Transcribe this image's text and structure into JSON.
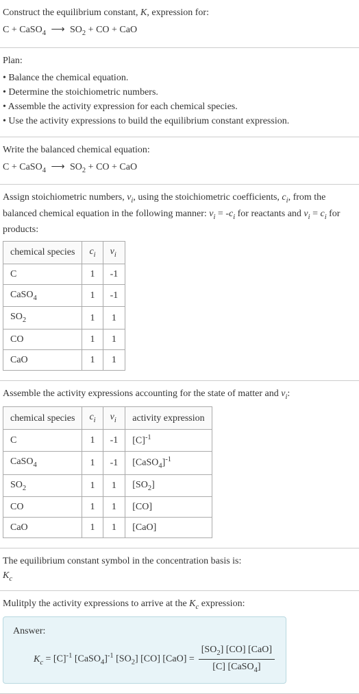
{
  "intro": {
    "line1": "Construct the equilibrium constant, K, expression for:",
    "equation": "C + CaSO₄ ⟶ SO₂ + CO + CaO"
  },
  "plan": {
    "heading": "Plan:",
    "items": [
      "Balance the chemical equation.",
      "Determine the stoichiometric numbers.",
      "Assemble the activity expression for each chemical species.",
      "Use the activity expressions to build the equilibrium constant expression."
    ]
  },
  "balanced": {
    "heading": "Write the balanced chemical equation:",
    "equation": "C + CaSO₄ ⟶ SO₂ + CO + CaO"
  },
  "stoich": {
    "text": "Assign stoichiometric numbers, νᵢ, using the stoichiometric coefficients, cᵢ, from the balanced chemical equation in the following manner: νᵢ = -cᵢ for reactants and νᵢ = cᵢ for products:",
    "headers": {
      "species": "chemical species",
      "ci": "cᵢ",
      "vi": "νᵢ"
    },
    "rows": [
      {
        "species": "C",
        "ci": "1",
        "vi": "-1"
      },
      {
        "species": "CaSO₄",
        "ci": "1",
        "vi": "-1"
      },
      {
        "species": "SO₂",
        "ci": "1",
        "vi": "1"
      },
      {
        "species": "CO",
        "ci": "1",
        "vi": "1"
      },
      {
        "species": "CaO",
        "ci": "1",
        "vi": "1"
      }
    ]
  },
  "activity": {
    "heading": "Assemble the activity expressions accounting for the state of matter and νᵢ:",
    "headers": {
      "species": "chemical species",
      "ci": "cᵢ",
      "vi": "νᵢ",
      "expr": "activity expression"
    },
    "rows": [
      {
        "species": "C",
        "ci": "1",
        "vi": "-1",
        "expr": "[C]⁻¹"
      },
      {
        "species": "CaSO₄",
        "ci": "1",
        "vi": "-1",
        "expr": "[CaSO₄]⁻¹"
      },
      {
        "species": "SO₂",
        "ci": "1",
        "vi": "1",
        "expr": "[SO₂]"
      },
      {
        "species": "CO",
        "ci": "1",
        "vi": "1",
        "expr": "[CO]"
      },
      {
        "species": "CaO",
        "ci": "1",
        "vi": "1",
        "expr": "[CaO]"
      }
    ]
  },
  "symbol": {
    "line1": "The equilibrium constant symbol in the concentration basis is:",
    "line2": "K_c"
  },
  "multiply": {
    "heading": "Mulitply the activity expressions to arrive at the K_c expression:"
  },
  "answer": {
    "label": "Answer:",
    "lhs": "K_c = [C]⁻¹ [CaSO₄]⁻¹ [SO₂] [CO] [CaO] =",
    "num": "[SO₂] [CO] [CaO]",
    "den": "[C] [CaSO₄]"
  },
  "chart_data": {
    "type": "table",
    "tables": [
      {
        "title": "Stoichiometric numbers",
        "columns": [
          "chemical species",
          "c_i",
          "ν_i"
        ],
        "rows": [
          [
            "C",
            1,
            -1
          ],
          [
            "CaSO4",
            1,
            -1
          ],
          [
            "SO2",
            1,
            1
          ],
          [
            "CO",
            1,
            1
          ],
          [
            "CaO",
            1,
            1
          ]
        ]
      },
      {
        "title": "Activity expressions",
        "columns": [
          "chemical species",
          "c_i",
          "ν_i",
          "activity expression"
        ],
        "rows": [
          [
            "C",
            1,
            -1,
            "[C]^-1"
          ],
          [
            "CaSO4",
            1,
            -1,
            "[CaSO4]^-1"
          ],
          [
            "SO2",
            1,
            1,
            "[SO2]"
          ],
          [
            "CO",
            1,
            1,
            "[CO]"
          ],
          [
            "CaO",
            1,
            1,
            "[CaO]"
          ]
        ]
      }
    ]
  }
}
